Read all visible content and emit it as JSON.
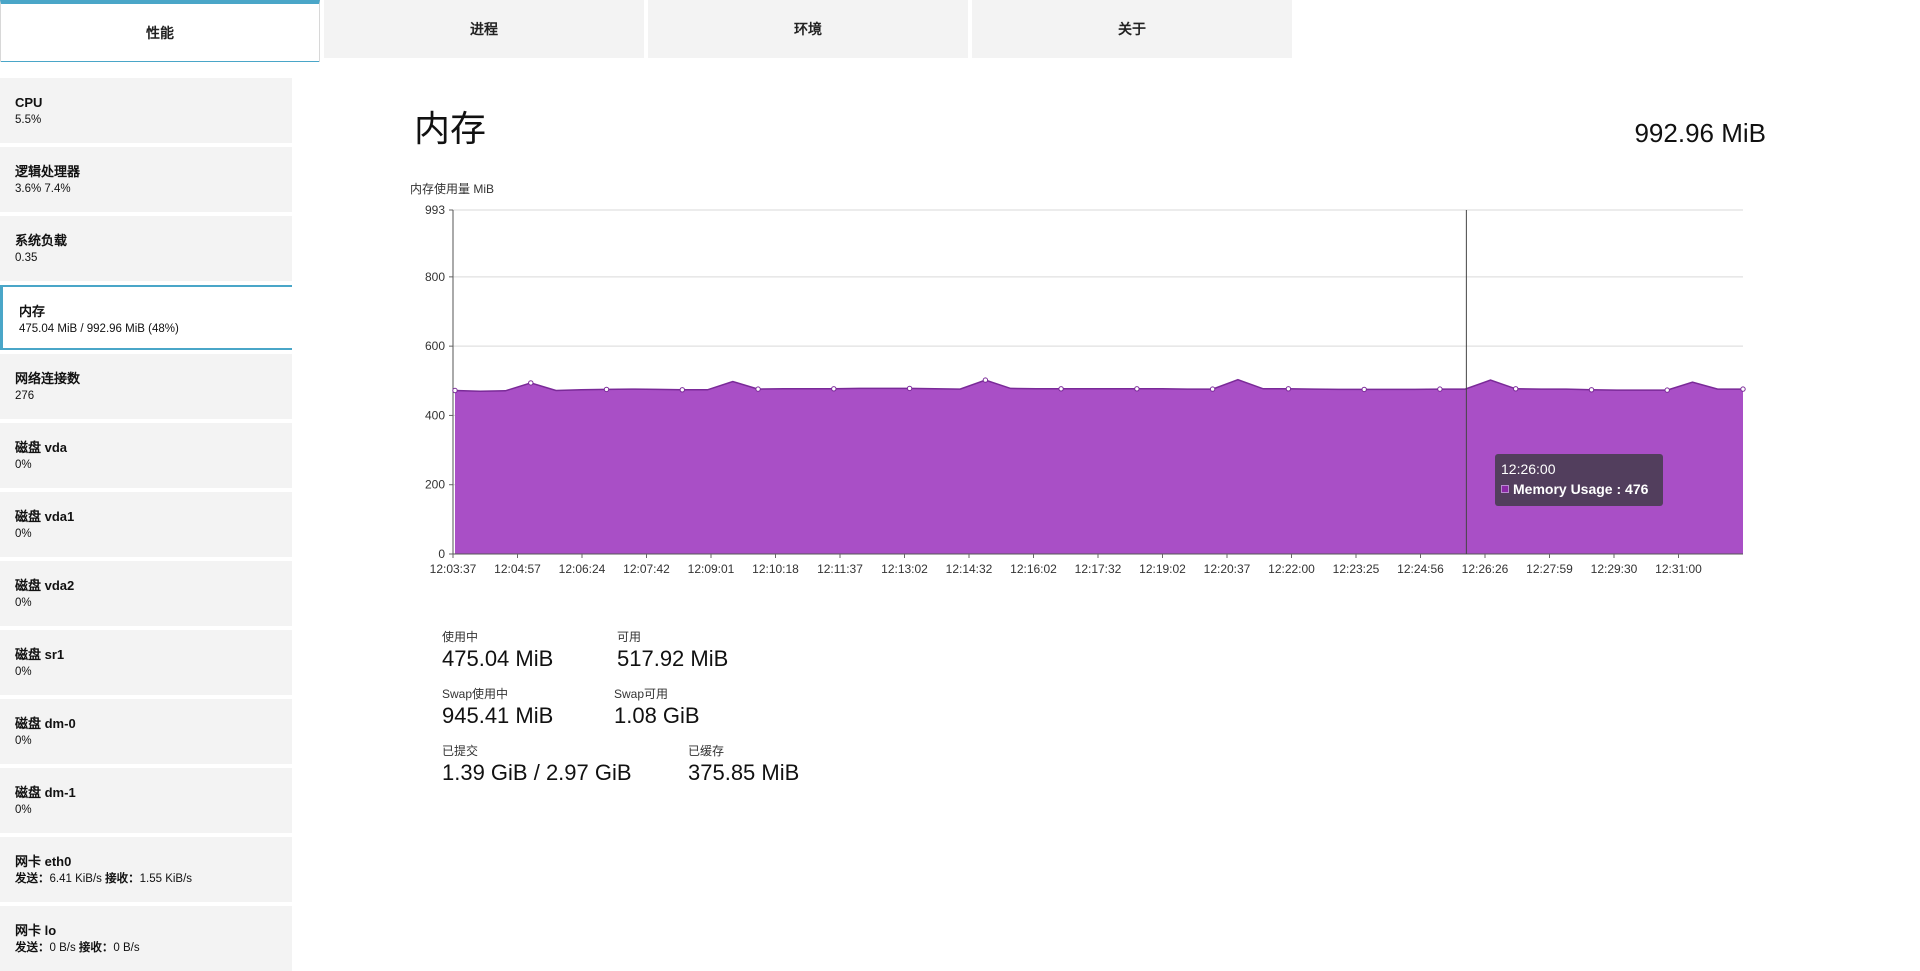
{
  "tabs": [
    {
      "label": "性能",
      "active": true
    },
    {
      "label": "进程",
      "active": false
    },
    {
      "label": "环境",
      "active": false
    },
    {
      "label": "关于",
      "active": false
    }
  ],
  "sidebar": {
    "items": [
      {
        "title": "CPU",
        "sub": "5.5%"
      },
      {
        "title": "逻辑处理器",
        "sub": "3.6% 7.4%"
      },
      {
        "title": "系统负载",
        "sub": "0.35"
      },
      {
        "title": "内存",
        "sub": "475.04 MiB / 992.96 MiB (48%)",
        "active": true
      },
      {
        "title": "网络连接数",
        "sub": "276"
      },
      {
        "title": "磁盘 vda",
        "sub": "0%"
      },
      {
        "title": "磁盘 vda1",
        "sub": "0%"
      },
      {
        "title": "磁盘 vda2",
        "sub": "0%"
      },
      {
        "title": "磁盘 sr1",
        "sub": "0%"
      },
      {
        "title": "磁盘 dm-0",
        "sub": "0%"
      },
      {
        "title": "磁盘 dm-1",
        "sub": "0%"
      },
      {
        "title": "网卡 eth0",
        "send_label": "发送：",
        "send": "6.41 KiB/s",
        "recv_label": "接收：",
        "recv": "1.55 KiB/s"
      },
      {
        "title": "网卡 lo",
        "send_label": "发送：",
        "send": "0 B/s",
        "recv_label": "接收：",
        "recv": "0 B/s"
      }
    ]
  },
  "main": {
    "title": "内存",
    "total": "992.96 MiB"
  },
  "tooltip": {
    "time": "12:26:00",
    "label": "Memory Usage : 476"
  },
  "stats": {
    "in_use_label": "使用中",
    "in_use": "475.04 MiB",
    "available_label": "可用",
    "available": "517.92 MiB",
    "swap_used_label": "Swap使用中",
    "swap_used": "945.41 MiB",
    "swap_free_label": "Swap可用",
    "swap_free": "1.08 GiB",
    "committed_label": "已提交",
    "committed": "1.39 GiB / 2.97 GiB",
    "cached_label": "已缓存",
    "cached": "375.85 MiB"
  },
  "colors": {
    "accent": "#4aa6c8",
    "area_fill": "#a94fc6",
    "area_line": "#7a2a98"
  },
  "chart_data": {
    "type": "area",
    "ylabel": "内存使用量 MiB",
    "ylim": [
      0,
      993
    ],
    "yticks": [
      0,
      200,
      400,
      600,
      800,
      993
    ],
    "grid": true,
    "x": [
      "12:03:37",
      "12:04:57",
      "12:06:24",
      "12:07:42",
      "12:09:01",
      "12:10:18",
      "12:11:37",
      "12:13:02",
      "12:14:32",
      "12:16:02",
      "12:17:32",
      "12:19:02",
      "12:20:37",
      "12:22:00",
      "12:23:25",
      "12:24:56",
      "12:26:26",
      "12:27:59",
      "12:29:30",
      "12:31:00"
    ],
    "series": [
      {
        "values": [
          472,
          470,
          471,
          494,
          472,
          474,
          475,
          476,
          475,
          474,
          474,
          498,
          476,
          477,
          477,
          477,
          478,
          478,
          478,
          477,
          476,
          502,
          478,
          477,
          477,
          477,
          477,
          477,
          477,
          476,
          476,
          503,
          477,
          477,
          476,
          475,
          475,
          475,
          475,
          476,
          476,
          502,
          477,
          476,
          476,
          474,
          473,
          473,
          473,
          496,
          476,
          476
        ]
      }
    ],
    "crosshair_x": "12:26:00"
  }
}
